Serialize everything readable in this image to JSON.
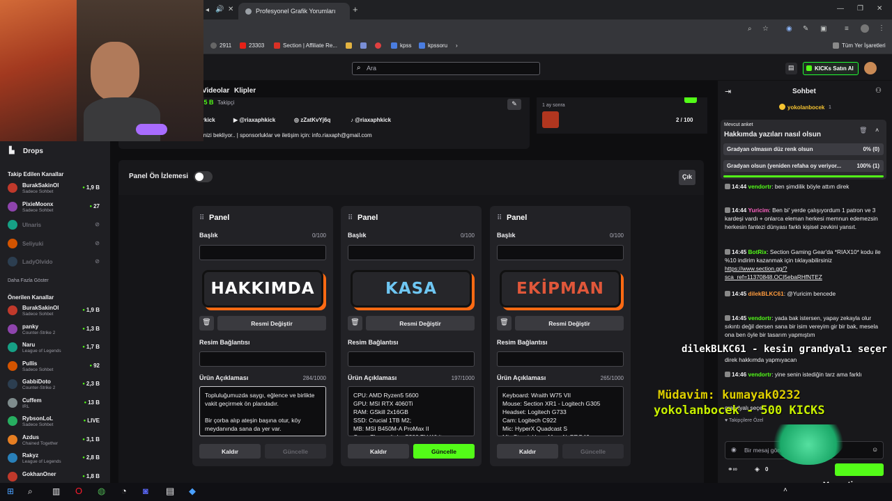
{
  "browser": {
    "tabs": [
      {
        "label": "Profesyonel Grafik Yorumları"
      }
    ],
    "bookmarks": [
      "2911",
      "23303",
      "Section | Affiliate Re...",
      "kpss",
      "kpssoru"
    ],
    "all_bookmarks": "Tüm Yer İşaretleri"
  },
  "header": {
    "search_placeholder": "Ara",
    "kicks_button": "KICKs Satın Al"
  },
  "sidebar": {
    "drops_label": "Drops",
    "followed_title": "Takip Edilen Kanallar",
    "followed": [
      {
        "name": "BurakSakinOl",
        "category": "Sadece Sohbet",
        "viewers": "1,9 B",
        "live": true
      },
      {
        "name": "PixieMoonx",
        "category": "Sadece Sohbet",
        "viewers": "27",
        "live": true
      },
      {
        "name": "Ulnaris",
        "category": "",
        "viewers": "",
        "live": false
      },
      {
        "name": "Seliyuki",
        "category": "",
        "viewers": "",
        "live": false
      },
      {
        "name": "LadyOlvido",
        "category": "",
        "viewers": "",
        "live": false
      }
    ],
    "show_more": "Daha Fazla Göster",
    "recommended_title": "Önerilen Kanallar",
    "recommended": [
      {
        "name": "BurakSakinOl",
        "category": "Sadece Sohbet",
        "viewers": "1,9 B"
      },
      {
        "name": "panky",
        "category": "Counter-Strike 2",
        "viewers": "1,3 B"
      },
      {
        "name": "Naru",
        "category": "League of Legends",
        "viewers": "1,7 B"
      },
      {
        "name": "Pullis",
        "category": "Sadece Sohbet",
        "viewers": "92"
      },
      {
        "name": "GabbiDoto",
        "category": "Counter-Strike 2",
        "viewers": "2,3 B"
      },
      {
        "name": "Cuffem",
        "category": "IRL",
        "viewers": "13 B"
      },
      {
        "name": "RybsonLoL",
        "category": "Sadece Sohbet",
        "viewers": "LIVE"
      },
      {
        "name": "Azdus",
        "category": "Chained Together",
        "viewers": "3,1 B"
      },
      {
        "name": "Rakyz",
        "category": "League of Legends",
        "viewers": "2,8 B"
      },
      {
        "name": "GokhanOner",
        "category": "",
        "viewers": "1,8 B"
      }
    ]
  },
  "channel_nav": {
    "videos": "Videolar",
    "clips": "Klipler"
  },
  "profile": {
    "followers": ",5 B",
    "followers_label": "Takipçi",
    "socials": [
      "rkick",
      "@riaxaphkick",
      "zZatKvYj6q",
      "@riaxaphkick"
    ],
    "bio": "inizi bekliyor.. | sponsorluklar ve iletişim için: info.riaxaph@gmail.com"
  },
  "schedule": {
    "when": "1 ay sonra",
    "count": "2 / 100"
  },
  "panel_editor": {
    "preview_label": "Panel Ön İzlemesi",
    "exit_button": "Çık",
    "panels": [
      {
        "title": "Panel",
        "heading_label": "Başlık",
        "heading_count": "0/100",
        "banner": "HAKKIMDA",
        "banner_color": "#ffffff",
        "change_image": "Resmi Değiştir",
        "link_label": "Resim Bağlantısı",
        "desc_label": "Ürün Açıklaması",
        "desc_count": "284/1000",
        "desc": "Topluluğumuzda saygı, eğlence ve birlikte vakit geçirmek ön plandadır.\n\nBir çorba alıp ateşin başına otur, köy meydanında sana da yer var.",
        "remove": "Kaldır",
        "update": "Güncelle",
        "update_active": false
      },
      {
        "title": "Panel",
        "heading_label": "Başlık",
        "heading_count": "0/100",
        "banner": "KASA",
        "banner_color": "#6ec6f2",
        "change_image": "Resmi Değiştir",
        "link_label": "Resim Bağlantısı",
        "desc_label": "Ürün Açıklaması",
        "desc_count": "197/1000",
        "desc": "CPU: AMD Ryzen5 5600\nGPU: MSI RTX 4060Ti\nRAM: GSkill 2x16GB\nSSD: Crucial 1TB M2;\nMB: MSI B450M-A ProMax II\nCase: Thermaltake S200 TH White",
        "remove": "Kaldır",
        "update": "Güncelle",
        "update_active": true
      },
      {
        "title": "Panel",
        "heading_label": "Başlık",
        "heading_count": "0/100",
        "banner": "EKİPMAN",
        "banner_color": "#e0573a",
        "change_image": "Resmi Değiştir",
        "link_label": "Resim Bağlantısı",
        "desc_label": "Ürün Açıklaması",
        "desc_count": "265/1000",
        "desc": "Keyboard: Wraith W75 VII\nMouse: Section XR1 - Logitech G305\nHeadset: Logitech G733\nCam: Logitech C922\nMic: HyperX Quadcast S\nMic Stand: Hepa Merz NyPRO46",
        "remove": "Kaldır",
        "update": "Güncelle",
        "update_active": false
      }
    ]
  },
  "chat": {
    "title": "Sohbet",
    "pinned_user": "yokolanbocek",
    "pinned_count": "1",
    "poll": {
      "label": "Mevcut anket",
      "question": "Hakkımda yazıları nasıl olsun",
      "options": [
        {
          "text": "Gradyan olmasın düz renk olsun",
          "result": "0% (0)",
          "fraction": 0
        },
        {
          "text": "Gradyan olsun (yeniden refaha oy veriyor...",
          "result": "100% (1)",
          "fraction": 1
        }
      ]
    },
    "messages": [
      {
        "time": "14:44",
        "user": "vendortr",
        "color": "#53fc18",
        "text": "ben şimdilik böyle attım direk"
      },
      {
        "time": "14:44",
        "user": "Yuricim",
        "color": "#ff63c3",
        "text": "Ben bi' yerde çalışıyordum 1 patron ve 3 kardeşi vardı + onlarca eleman herkesi memnun edemezsin herkesin fantezi dünyası farklı kişisel zevkini yansıt."
      },
      {
        "time": "14:45",
        "user": "BotRix",
        "color": "#53fc18",
        "text": "Section Gaming Gear'da *RIAX10* kodu ile %10 indirim kazanmak için tıklayabilirsiniz",
        "link": "https://www.section.gg/?sca_ref=11370848.OCI5ebaRHfNTEZ"
      },
      {
        "time": "14:45",
        "user": "dilekBLKC61",
        "color": "#ff9b3d",
        "text": "@Yuricim bencede"
      },
      {
        "time": "14:45",
        "user": "vendortr",
        "color": "#53fc18",
        "text": "yada bak istersen, yapay zekayla olur sıkıntı değil dersen sana bir isim vereyim gir bir bak, mesela ona ben öyle bir tasarım yapmıştım"
      },
      {
        "time": "",
        "user": "",
        "color": "#53fc18",
        "text": "direk hakkımda yapmıyacan"
      },
      {
        "time": "14:46",
        "user": "vendortr",
        "color": "#53fc18",
        "text": "yine senin istediğin tarz ama farklı"
      },
      {
        "time": "",
        "user": "",
        "color": "#53fc18",
        "text": "grandyalı seçer"
      }
    ],
    "followers_only": "Takipçilere Özel",
    "input_placeholder": "Bir mesaj gönder",
    "kicks_count": "0"
  },
  "overlay": {
    "alert_line": "dilekBLKC61 - kesin grandyalı seçer",
    "mudavim": "Müdavim: kumayak0232",
    "kicks_alert": "yokolanbocek - 500 KICKS",
    "sponsor": "section"
  }
}
